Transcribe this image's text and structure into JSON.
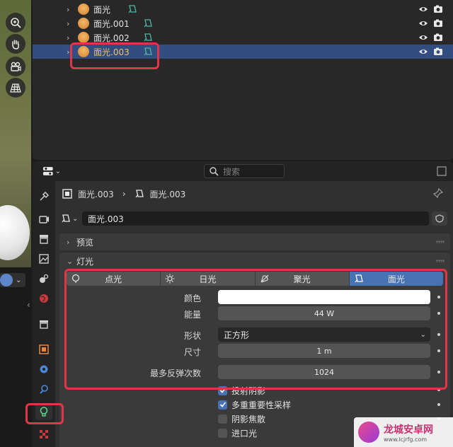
{
  "outliner": {
    "rows": [
      {
        "label": "面光",
        "selected": false
      },
      {
        "label": "面光.001",
        "selected": false
      },
      {
        "label": "面光.002",
        "selected": false
      },
      {
        "label": "面光.003",
        "selected": true
      }
    ]
  },
  "properties": {
    "search_placeholder": "搜索",
    "breadcrumb": {
      "object": "面光.003",
      "data": "面光.003"
    },
    "datablock_name": "面光.003",
    "panels": {
      "preview": "预览",
      "light": "灯光"
    },
    "light_types": [
      {
        "label": "点光",
        "icon": "point-light-icon",
        "active": false
      },
      {
        "label": "日光",
        "icon": "sun-light-icon",
        "active": false
      },
      {
        "label": "聚光",
        "icon": "spot-light-icon",
        "active": false
      },
      {
        "label": "面光",
        "icon": "area-light-icon",
        "active": true
      }
    ],
    "fields": {
      "color_label": "颜色",
      "color_value": "#ffffff",
      "energy_label": "能量",
      "energy_value": "44 W",
      "shape_label": "形状",
      "shape_value": "正方形",
      "size_label": "尺寸",
      "size_value": "1 m",
      "bounces_label": "最多反弹次数",
      "bounces_value": "1024"
    },
    "checkboxes": [
      {
        "label": "投射阴影",
        "checked": true
      },
      {
        "label": "多重重要性采样",
        "checked": true
      },
      {
        "label": "阴影焦散",
        "checked": false
      },
      {
        "label": "进口光",
        "checked": false
      }
    ]
  },
  "watermark": {
    "title": "龙城安卓网",
    "url": "www.lcjrfg.com"
  },
  "colors": {
    "accent": "#4772b3",
    "selection": "#334d80",
    "highlight": "#e03649",
    "active_tab": "#5bd38a"
  }
}
